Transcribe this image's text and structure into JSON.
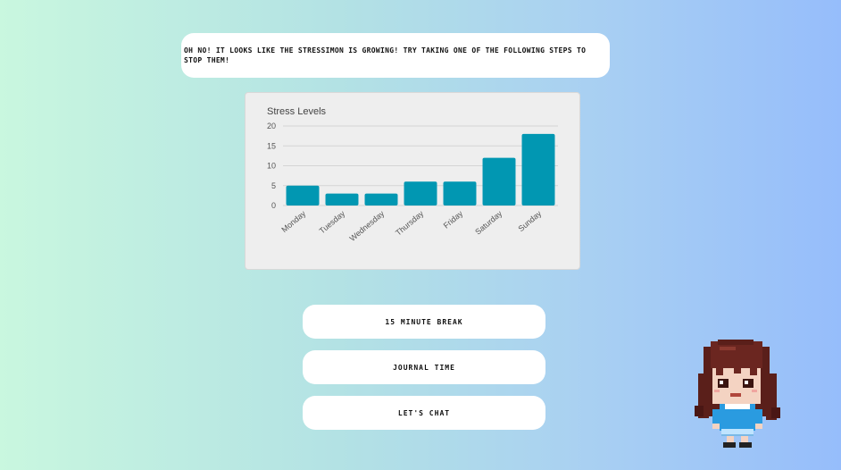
{
  "message": {
    "text": "Oh no! It looks like the Stressimon is growing! Try taking one of the following steps to stop them!"
  },
  "chart_data": {
    "type": "bar",
    "title": "Stress Levels",
    "categories": [
      "Monday",
      "Tuesday",
      "Wednesday",
      "Thursday",
      "Friday",
      "Saturday",
      "Sunday"
    ],
    "values": [
      5,
      3,
      3,
      6,
      6,
      12,
      18
    ],
    "ylim": [
      0,
      20
    ],
    "yticks": [
      0,
      5,
      10,
      15,
      20
    ],
    "grid": true,
    "bar_color": "#0197b2"
  },
  "actions": [
    {
      "label": "15 minute break"
    },
    {
      "label": "journal  time"
    },
    {
      "label": "let's chat"
    }
  ],
  "colors": {
    "background_start": "#c9f7df",
    "background_end": "#96bdfb"
  }
}
